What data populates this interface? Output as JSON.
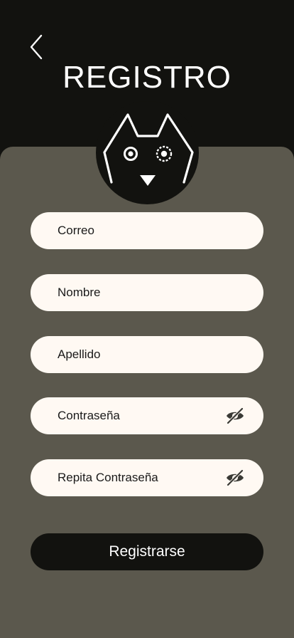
{
  "header": {
    "title": "REGISTRO",
    "back_icon": "chevron-left-icon"
  },
  "avatar": {
    "icon": "cat-face-icon"
  },
  "form": {
    "email": {
      "placeholder": "Correo",
      "value": ""
    },
    "first_name": {
      "placeholder": "Nombre",
      "value": ""
    },
    "last_name": {
      "placeholder": "Apellido",
      "value": ""
    },
    "password": {
      "placeholder": "Contraseña",
      "value": "",
      "toggle_icon": "eye-off-icon"
    },
    "password_repeat": {
      "placeholder": "Repita Contraseña",
      "value": "",
      "toggle_icon": "eye-off-icon"
    },
    "submit_label": "Registrarse"
  },
  "colors": {
    "background": "#12120f",
    "panel": "#5b584d",
    "field": "#fff9f3",
    "text_light": "#ffffff",
    "text_dark": "#1a1a1a"
  }
}
